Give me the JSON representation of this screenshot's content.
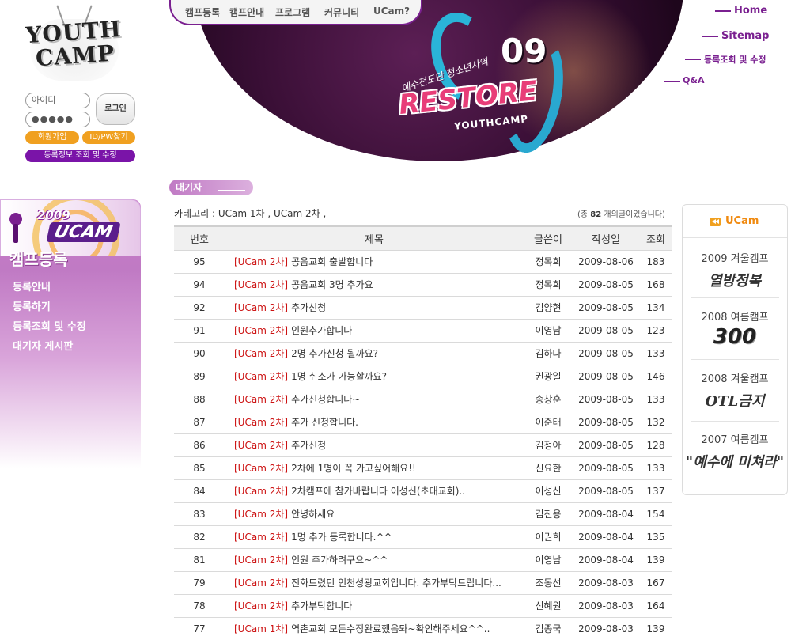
{
  "logo": {
    "text_line1": "YOUTH",
    "text_line2": "CAMP"
  },
  "login": {
    "id_placeholder": "아이디",
    "password_value": "●●●●●",
    "login_label": "로그인",
    "join_label": "회원가입",
    "find_label": "ID/PW찾기",
    "reginfo_label": "등록정보 조회 및 수정"
  },
  "side": {
    "banner_year": "2009",
    "banner_name": "UCAM",
    "title": "캠프등록",
    "menu": [
      "등록안내",
      "등록하기",
      "등록조회 및 수정",
      "대기자 게시판"
    ]
  },
  "top_nav": [
    "캠프등록",
    "캠프안내",
    "프로그램",
    "커뮤니티",
    "UCam?"
  ],
  "utility_links": [
    "Home",
    "Sitemap",
    "등록조회 및 수정",
    "Q&A"
  ],
  "header_banner": {
    "number": "09",
    "subtitle": "예수전도단 청소년사역",
    "title": "RESTORE",
    "sub": "YOUTHCAMP"
  },
  "board": {
    "tab_label": "대기자",
    "category_line": "카테고리 : UCam 1차 , UCam 2차 ,",
    "total_prefix": "(총",
    "total_count": "82",
    "total_suffix": "개의글이있습니다)",
    "columns": [
      "번호",
      "제목",
      "글쓴이",
      "작성일",
      "조회"
    ],
    "rows": [
      {
        "no": "95",
        "cat": "[UCam 2차]",
        "title": "공음교회 출발합니다",
        "author": "정목희",
        "date": "2009-08-06",
        "views": "183"
      },
      {
        "no": "94",
        "cat": "[UCam 2차]",
        "title": "공음교회 3명 추가요",
        "author": "정목희",
        "date": "2009-08-05",
        "views": "168"
      },
      {
        "no": "92",
        "cat": "[UCam 2차]",
        "title": "추가신청",
        "author": "김양현",
        "date": "2009-08-05",
        "views": "134"
      },
      {
        "no": "91",
        "cat": "[UCam 2차]",
        "title": "인원추가합니다",
        "author": "이영남",
        "date": "2009-08-05",
        "views": "123"
      },
      {
        "no": "90",
        "cat": "[UCam 2차]",
        "title": "2명 추가신청 될까요?",
        "author": "김하나",
        "date": "2009-08-05",
        "views": "133"
      },
      {
        "no": "89",
        "cat": "[UCam 2차]",
        "title": "1명 취소가 가능할까요?",
        "author": "권광일",
        "date": "2009-08-05",
        "views": "146"
      },
      {
        "no": "88",
        "cat": "[UCam 2차]",
        "title": "추가신청합니다~",
        "author": "송창훈",
        "date": "2009-08-05",
        "views": "133"
      },
      {
        "no": "87",
        "cat": "[UCam 2차]",
        "title": "추가 신청합니다.",
        "author": "이준태",
        "date": "2009-08-05",
        "views": "132"
      },
      {
        "no": "86",
        "cat": "[UCam 2차]",
        "title": "추가신청",
        "author": "김정아",
        "date": "2009-08-05",
        "views": "128"
      },
      {
        "no": "85",
        "cat": "[UCam 2차]",
        "title": "2차에 1명이 꼭 가고싶어해요!!",
        "author": "신요한",
        "date": "2009-08-05",
        "views": "133"
      },
      {
        "no": "84",
        "cat": "[UCam 2차]",
        "title": "2차캠프에 참가바랍니다 이성신(초대교회)..",
        "author": "이성신",
        "date": "2009-08-05",
        "views": "137"
      },
      {
        "no": "83",
        "cat": "[UCam 2차]",
        "title": "안녕하세요",
        "author": "김진용",
        "date": "2009-08-04",
        "views": "154"
      },
      {
        "no": "82",
        "cat": "[UCam 2차]",
        "title": "1명 추가 등록합니다.^^",
        "author": "이권희",
        "date": "2009-08-04",
        "views": "135"
      },
      {
        "no": "81",
        "cat": "[UCam 2차]",
        "title": "인원 추가하려구요~^^",
        "author": "이영남",
        "date": "2009-08-04",
        "views": "139"
      },
      {
        "no": "79",
        "cat": "[UCam 2차]",
        "title": "전화드렸던 인천성광교회입니다. 추가부탁드립니다...",
        "author": "조동선",
        "date": "2009-08-03",
        "views": "167"
      },
      {
        "no": "78",
        "cat": "[UCam 2차]",
        "title": "추가부탁합니다",
        "author": "신혜원",
        "date": "2009-08-03",
        "views": "164"
      },
      {
        "no": "77",
        "cat": "[UCam 1차]",
        "title": "역촌교회 모든수정완료했음돠~확인해주세요^^..",
        "author": "김종국",
        "date": "2009-08-03",
        "views": "139"
      }
    ]
  },
  "ucam_panel": {
    "title": "UCam",
    "camps": [
      {
        "label": "2009 겨울캠프",
        "logo": "열방정복"
      },
      {
        "label": "2008 여름캠프",
        "logo": "300"
      },
      {
        "label": "2008 겨울캠프",
        "logo": "OTL금지"
      },
      {
        "label": "2007 여름캠프",
        "logo": "\"예수에 미쳐라\""
      }
    ]
  },
  "colors": {
    "accent_purple": "#7a2090",
    "accent_orange": "#f0a020",
    "category_red": "#cc1111"
  }
}
